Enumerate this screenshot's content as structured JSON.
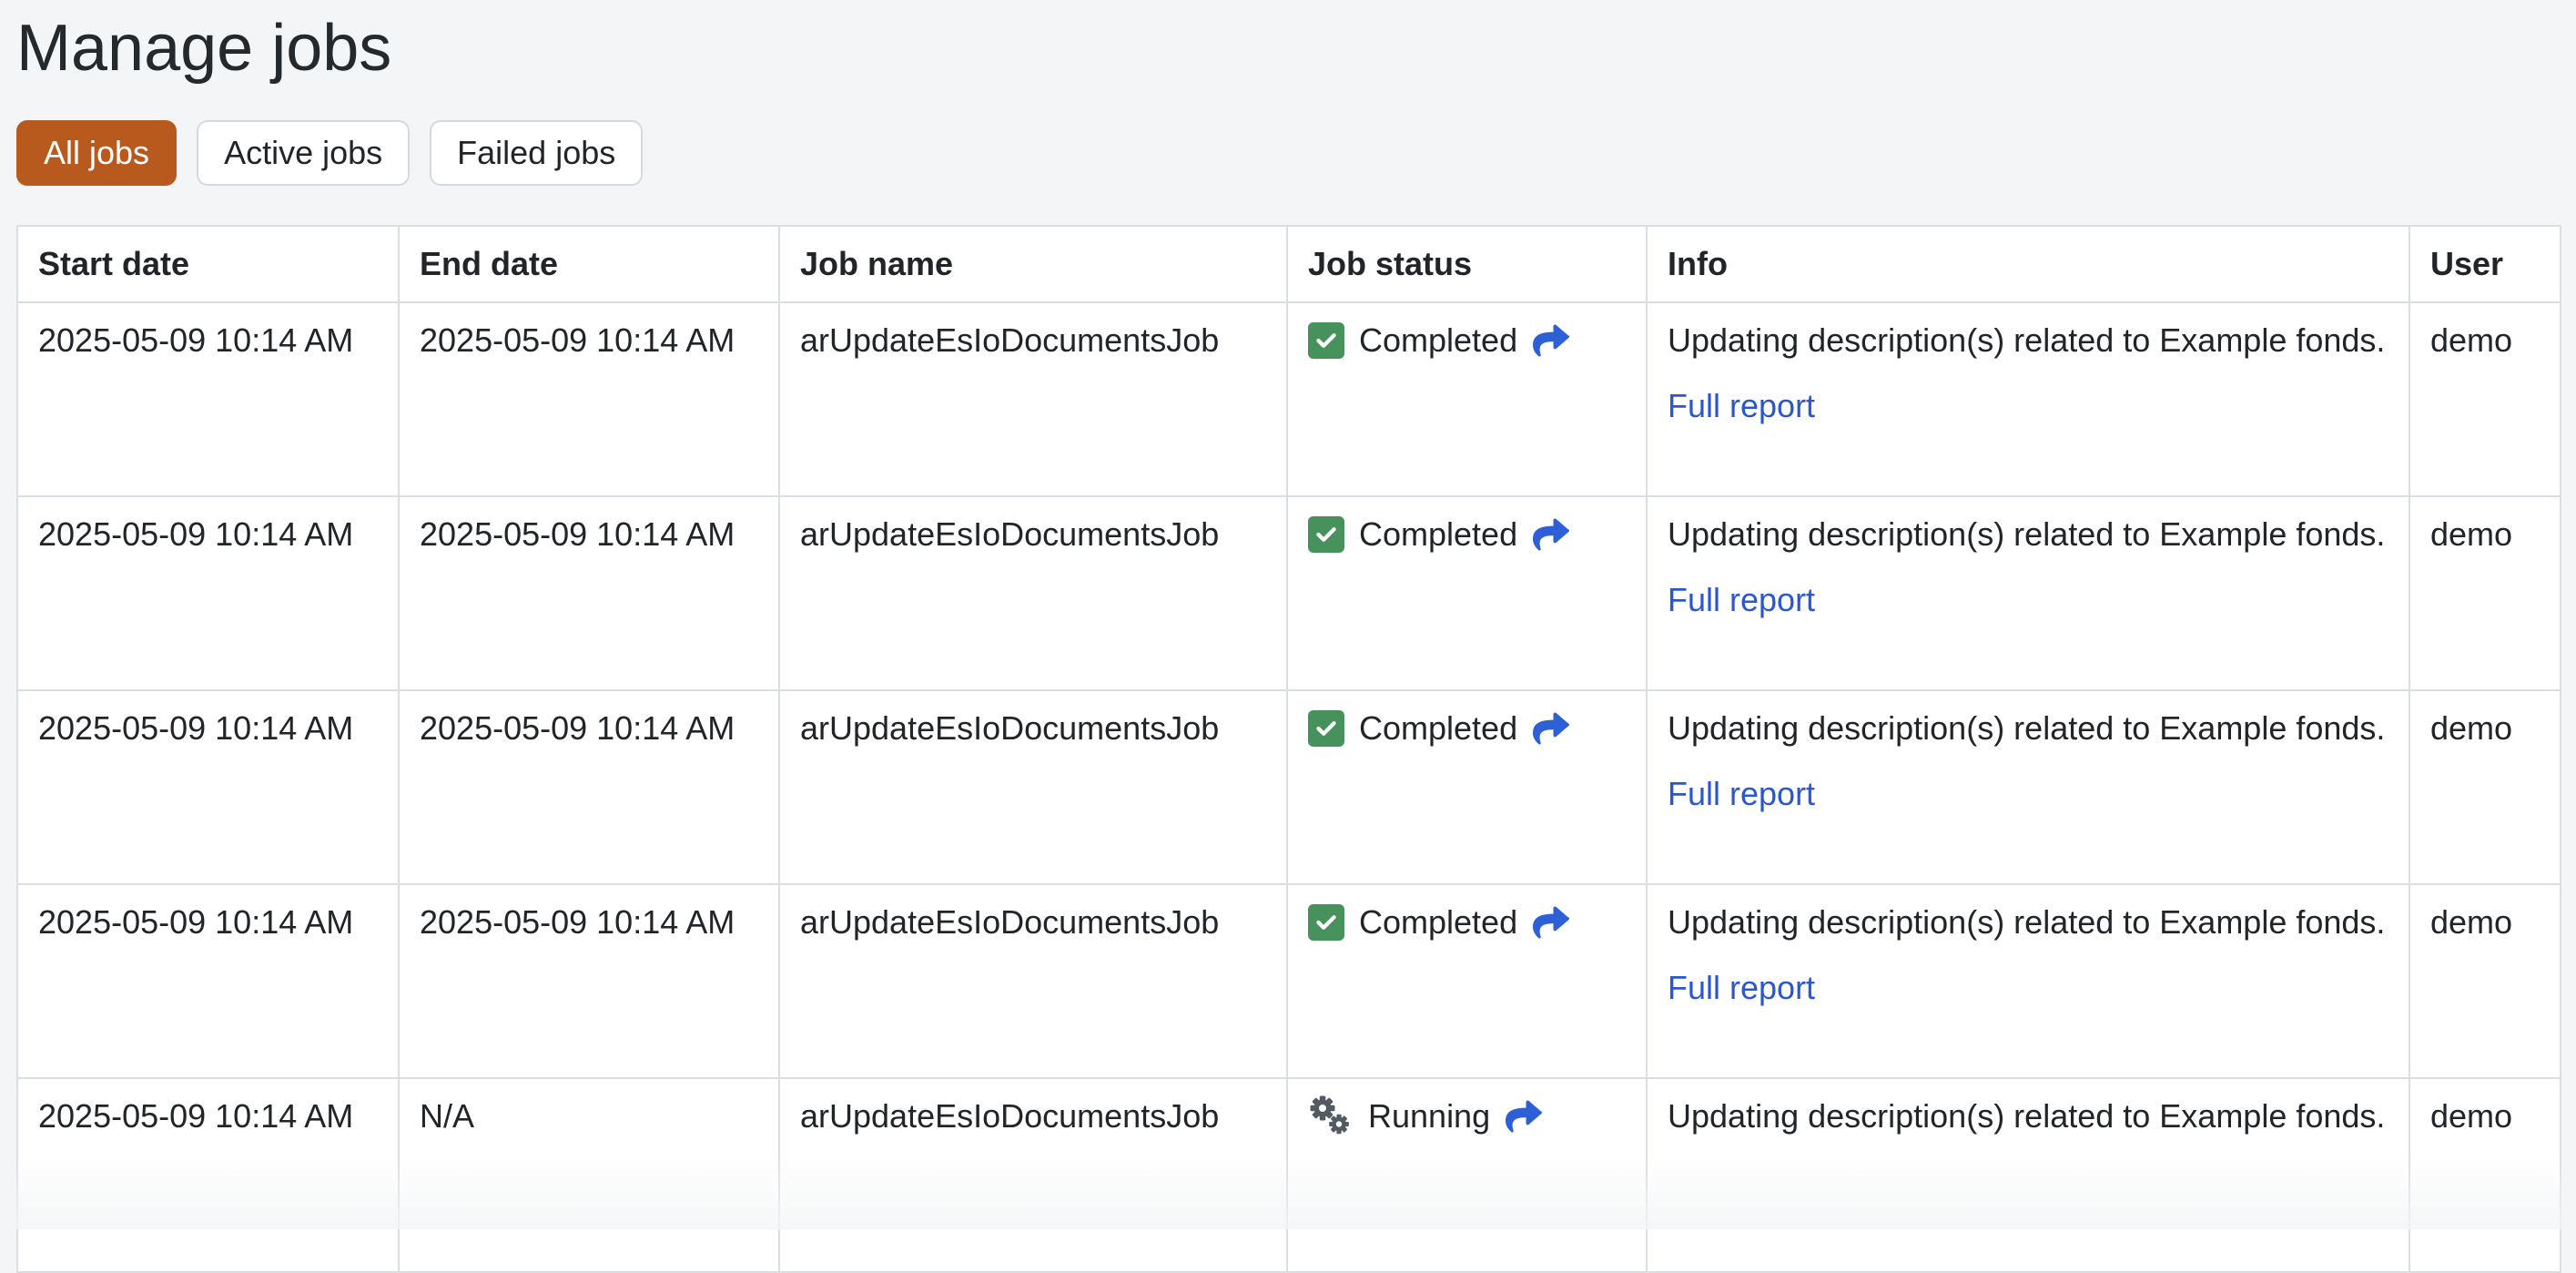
{
  "page": {
    "title": "Manage jobs"
  },
  "filters": {
    "items": [
      {
        "label": "All jobs",
        "active": true
      },
      {
        "label": "Active jobs",
        "active": false
      },
      {
        "label": "Failed jobs",
        "active": false
      }
    ]
  },
  "table": {
    "columns": [
      "Start date",
      "End date",
      "Job name",
      "Job status",
      "Info",
      "User"
    ],
    "rows": [
      {
        "start_date": "2025-05-09 10:14 AM",
        "end_date": "2025-05-09 10:14 AM",
        "job_name": "arUpdateEsIoDocumentsJob",
        "job_status": "Completed",
        "status_kind": "completed",
        "status_icon": "check-square-icon",
        "info": "Updating description(s) related to Example fonds.",
        "report_link": "Full report",
        "user": "demo"
      },
      {
        "start_date": "2025-05-09 10:14 AM",
        "end_date": "2025-05-09 10:14 AM",
        "job_name": "arUpdateEsIoDocumentsJob",
        "job_status": "Completed",
        "status_kind": "completed",
        "status_icon": "check-square-icon",
        "info": "Updating description(s) related to Example fonds.",
        "report_link": "Full report",
        "user": "demo"
      },
      {
        "start_date": "2025-05-09 10:14 AM",
        "end_date": "2025-05-09 10:14 AM",
        "job_name": "arUpdateEsIoDocumentsJob",
        "job_status": "Completed",
        "status_kind": "completed",
        "status_icon": "check-square-icon",
        "info": "Updating description(s) related to Example fonds.",
        "report_link": "Full report",
        "user": "demo"
      },
      {
        "start_date": "2025-05-09 10:14 AM",
        "end_date": "2025-05-09 10:14 AM",
        "job_name": "arUpdateEsIoDocumentsJob",
        "job_status": "Completed",
        "status_kind": "completed",
        "status_icon": "check-square-icon",
        "info": "Updating description(s) related to Example fonds.",
        "report_link": "Full report",
        "user": "demo"
      },
      {
        "start_date": "2025-05-09 10:14 AM",
        "end_date": "N/A",
        "job_name": "arUpdateEsIoDocumentsJob",
        "job_status": "Running",
        "status_kind": "running",
        "status_icon": "gears-icon",
        "info": "Updating description(s) related to Example fonds.",
        "user": "demo"
      }
    ]
  },
  "icons": {
    "status_share": "share-arrow-icon",
    "completed": "check-square-icon",
    "running": "gears-icon"
  },
  "colors": {
    "page_bg": "#f4f5f7",
    "accent_orange": "#b85a1d",
    "link_blue": "#2a57d0",
    "share_blue": "#2d5fd6",
    "status_green": "#47915c",
    "gear_gray": "#545a61",
    "table_border": "#dadde2"
  }
}
